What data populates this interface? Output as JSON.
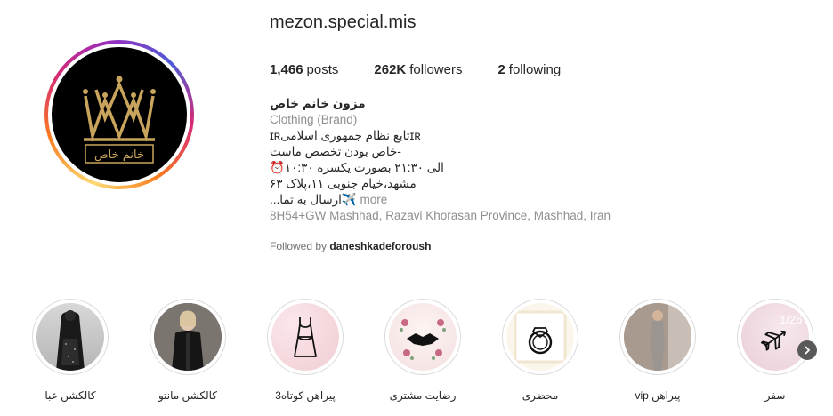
{
  "profile": {
    "username": "mezon.special.mis",
    "stats": {
      "posts_count": "1,466",
      "posts_label": "posts",
      "followers_count": "262K",
      "followers_label": "followers",
      "following_count": "2",
      "following_label": "following"
    },
    "avatar_logo_text": "خانم خاص",
    "bio": {
      "name": "مزون خانم خاص",
      "category": "Clothing (Brand)",
      "lines": [
        "ɪʀتابع نظام جمهوری اسلامیɪʀ",
        "-خاص بودن تخصص ماست",
        "الی ۲۱:۳۰ بصورت یکسره ۱۰:۳۰⏰",
        "مشهد،خیام جنوبی ۱۱،پلاک ۶۳"
      ],
      "last_line": "✈️ارسال به تما...",
      "more": "more",
      "location": "8H54+GW Mashhad, Razavi Khorasan Province, Mashhad, Iran"
    },
    "followed_by_prefix": "Followed by",
    "followed_by_user": "daneshkadeforoush"
  },
  "highlights": [
    {
      "label": "کالکشن عبا",
      "icon": "abaya-photo"
    },
    {
      "label": "کالکشن مانتو",
      "icon": "manteau-photo"
    },
    {
      "label": "پیراهن کوتاه3",
      "icon": "dress-icon"
    },
    {
      "label": "رضایت مشتری",
      "icon": "handshake-icon"
    },
    {
      "label": "محضری",
      "icon": "ring-icon"
    },
    {
      "label": "پیراهن vip",
      "icon": "gown-photo"
    },
    {
      "label": "سفر",
      "icon": "airplane-icon"
    }
  ],
  "carousel": {
    "page_indicator": "1/26"
  },
  "colors": {
    "text": "#262626",
    "secondary": "#8e8e8e",
    "highlight_border": "#dbdbdb"
  }
}
